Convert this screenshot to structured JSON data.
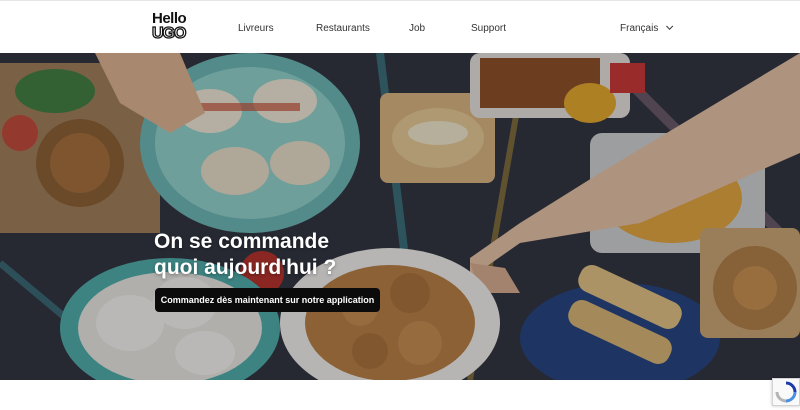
{
  "header": {
    "logo": {
      "line1": "Hello",
      "line2": "UGO"
    },
    "nav": [
      {
        "label": "Livreurs"
      },
      {
        "label": "Restaurants"
      },
      {
        "label": "Job"
      },
      {
        "label": "Support"
      }
    ],
    "language": {
      "label": "Français",
      "icon": "chevron-down-icon"
    }
  },
  "hero": {
    "title_line1": "On se commande",
    "title_line2": "quoi aujourd'hui ?",
    "cta_label": "Commandez dès maintenant sur notre application"
  },
  "recaptcha": {
    "icon": "recaptcha-icon"
  },
  "colors": {
    "hero_overlay": "#1d2027",
    "cta_bg": "#0b0b0b",
    "accent_teal": "#4aa9a6",
    "accent_pink": "#d9a0b9"
  }
}
